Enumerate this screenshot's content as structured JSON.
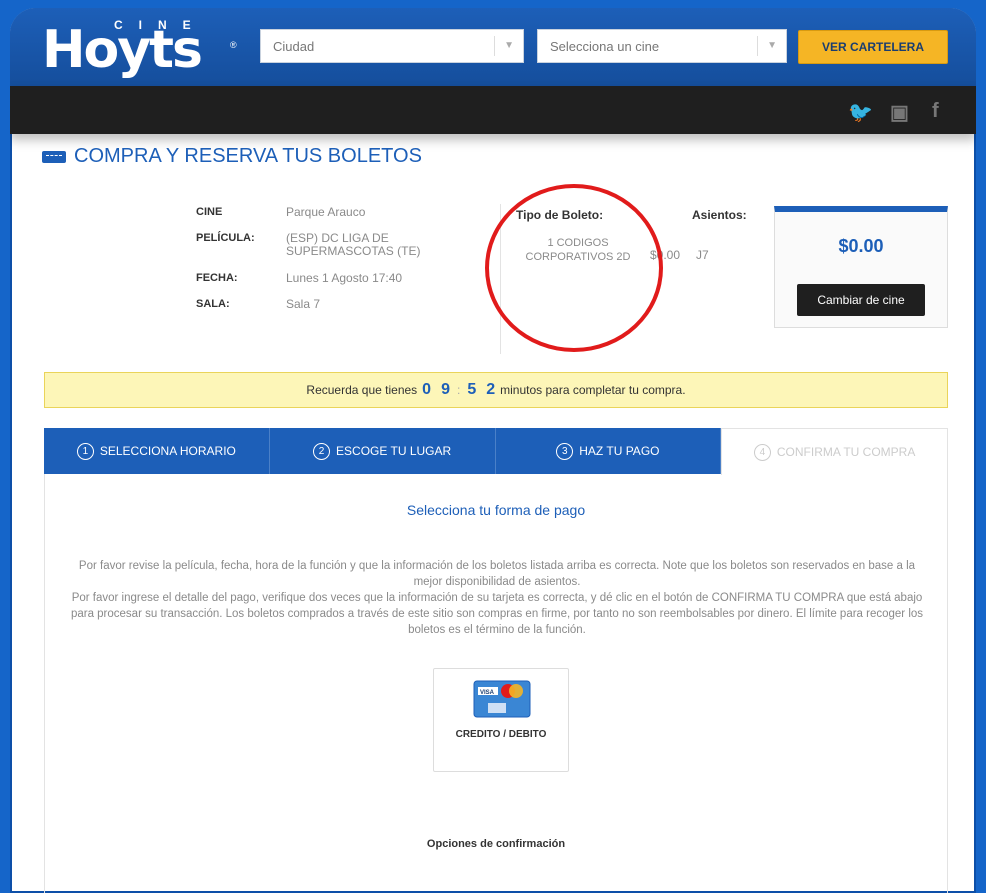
{
  "header": {
    "logo_cine": "CINE",
    "logo_main": "Hoyts",
    "logo_reg": "®",
    "city_select": "Ciudad",
    "cinema_select": "Selecciona un cine",
    "ver_cartelera": "VER CARTELERA"
  },
  "social": {
    "twitter": "🐦",
    "youtube": "▣",
    "facebook": "f"
  },
  "page": {
    "title": "COMPRA Y RESERVA TUS BOLETOS"
  },
  "info": {
    "cine_label": "CINE",
    "cine_value": "Parque Arauco",
    "pelicula_label": "PELÍCULA:",
    "pelicula_value": "(ESP) DC LIGA DE SUPERMASCOTAS (TE)",
    "fecha_label": "FECHA:",
    "fecha_value": "Lunes 1 Agosto 17:40",
    "sala_label": "SALA:",
    "sala_value": "Sala 7"
  },
  "ticket": {
    "tipo_title": "Tipo de Boleto:",
    "tipo_value": "1 CODIGOS CORPORATIVOS 2D",
    "price": "$0.00",
    "asientos_title": "Asientos:",
    "seat": "J7"
  },
  "total": {
    "amount": "$0.00",
    "cambiar": "Cambiar de cine"
  },
  "timer": {
    "before": "Recuerda que tienes",
    "d1": "0",
    "d2": "9",
    "colon": ":",
    "d3": "5",
    "d4": "2",
    "after": "minutos para completar tu compra."
  },
  "steps": [
    {
      "num": "1",
      "label": "SELECCIONA HORARIO"
    },
    {
      "num": "2",
      "label": "ESCOGE TU LUGAR"
    },
    {
      "num": "3",
      "label": "HAZ TU PAGO"
    },
    {
      "num": "4",
      "label": "CONFIRMA TU COMPRA"
    }
  ],
  "payment": {
    "title": "Selecciona tu forma de pago",
    "p1": "Por favor revise la película, fecha, hora de la función y que la información de los boletos listada arriba es correcta. Note que los boletos son reservados en base a la mejor disponibilidad de asientos.",
    "p2": "Por favor ingrese el detalle del pago, verifique dos veces que la información de su tarjeta es correcta, y dé clic en el botón de CONFIRMA TU COMPRA que está abajo para procesar su transacción. Los boletos comprados a través de este sitio son compras en firme, por tanto no son reembolsables por dinero. El límite para recoger los boletos es el término de la función.",
    "card_label": "CREDITO / DEBITO",
    "card_visa": "VISA",
    "opciones": "Opciones de confirmación"
  },
  "colors": {
    "brand_blue": "#1d5fb8",
    "accent_yellow": "#f5b525",
    "annotation_red": "#e11b1b"
  }
}
